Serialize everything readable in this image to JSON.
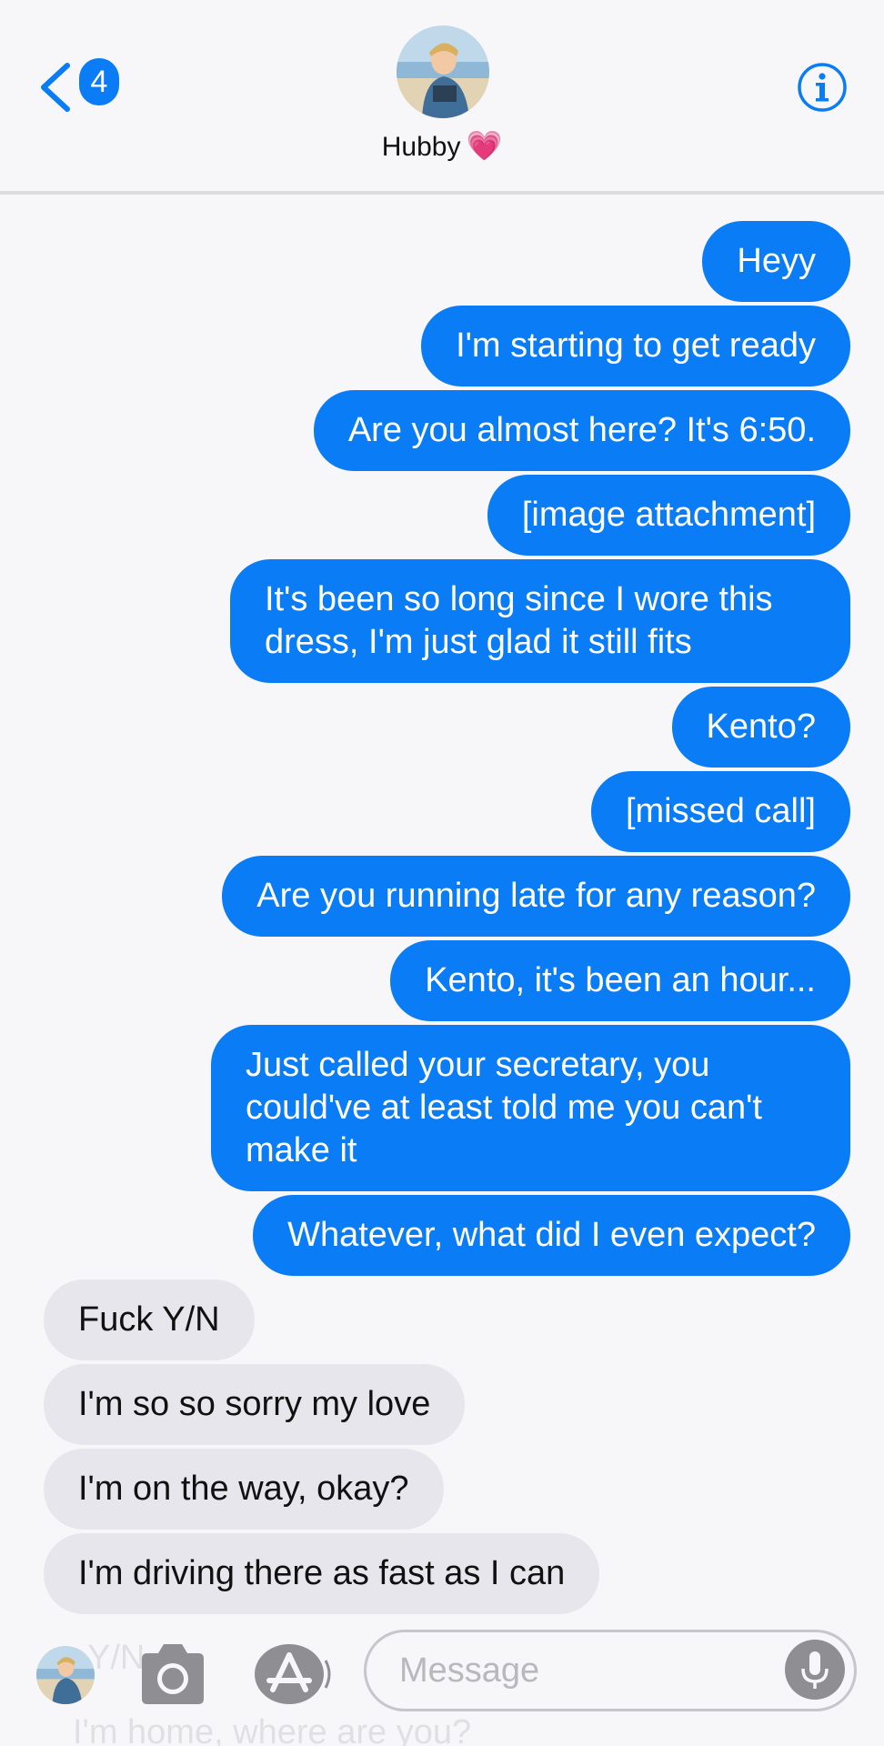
{
  "header": {
    "back_badge": "4",
    "contact_name": "Hubby",
    "contact_emoji": "💗",
    "info_icon": "info-icon"
  },
  "messages": [
    {
      "from": "me",
      "text": "Heyy"
    },
    {
      "from": "me",
      "text": "I'm starting to get ready"
    },
    {
      "from": "me",
      "text": "Are you almost here? It's 6:50."
    },
    {
      "from": "me",
      "text": "[image attachment]"
    },
    {
      "from": "me",
      "text": "It's been so long since I wore this dress, I'm just glad it still fits"
    },
    {
      "from": "me",
      "text": "Kento?"
    },
    {
      "from": "me",
      "text": "[missed call]"
    },
    {
      "from": "me",
      "text": "Are you running late for any reason?"
    },
    {
      "from": "me",
      "text": "Kento, it's been an hour..."
    },
    {
      "from": "me",
      "text": "Just called your secretary, you could've at least told me you can't make it"
    },
    {
      "from": "me",
      "text": "Whatever, what did I even expect?"
    },
    {
      "from": "them",
      "text": "Fuck Y/N"
    },
    {
      "from": "them",
      "text": "I'm so so sorry my love"
    },
    {
      "from": "them",
      "text": "I'm on the way, okay?"
    },
    {
      "from": "them",
      "text": "I'm driving there as fast as I can"
    }
  ],
  "input": {
    "placeholder": "Message",
    "ghost_top": "Y/N",
    "ghost_bottom": "I'm home, where are you?"
  },
  "colors": {
    "sent_bubble": "#0a7cf5",
    "received_bubble": "#e7e6ec",
    "accent": "#0a7cf5"
  }
}
